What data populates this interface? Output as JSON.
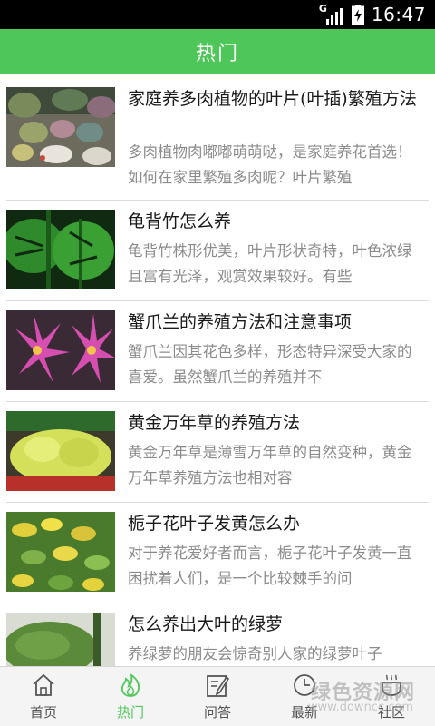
{
  "status_bar": {
    "time": "16:47",
    "network": "G"
  },
  "header": {
    "title": "热门"
  },
  "articles": [
    {
      "title": "家庭养多肉植物的叶片(叶插)繁殖方法",
      "summary": "多肉植物肉嘟嘟萌萌哒，是家庭养花首选！如何在家里繁殖多肉呢？叶片繁殖",
      "image": "succulents-photo"
    },
    {
      "title": "龟背竹怎么养",
      "summary": "龟背竹株形优美，叶片形状奇特，叶色浓绿且富有光泽，观赏效果较好。有些",
      "image": "monstera-photo"
    },
    {
      "title": "蟹爪兰的养殖方法和注意事项",
      "summary": "蟹爪兰因其花色多样，形态特异深受大家的喜爱。虽然蟹爪兰的养殖并不",
      "image": "christmas-cactus-photo"
    },
    {
      "title": "黄金万年草的养殖方法",
      "summary": "黄金万年草是薄雪万年草的自然变种，黄金万年草养殖方法也相对容",
      "image": "golden-sedum-photo"
    },
    {
      "title": "栀子花叶子发黄怎么办",
      "summary": "对于养花爱好者而言，栀子花叶子发黄一直困扰着人们，是一个比较棘手的问",
      "image": "gardenia-yellow-leaves-photo"
    },
    {
      "title": "怎么养出大叶的绿萝",
      "summary": "养绿萝的朋友会惊奇别人家的绿萝叶子",
      "image": "pothos-photo"
    }
  ],
  "tabs": [
    {
      "label": "首页",
      "icon": "home-icon"
    },
    {
      "label": "热门",
      "icon": "flame-icon"
    },
    {
      "label": "问答",
      "icon": "edit-note-icon"
    },
    {
      "label": "最新",
      "icon": "clock-icon"
    },
    {
      "label": "社区",
      "icon": "coffee-cup-icon"
    }
  ],
  "active_tab": "热门",
  "watermark": {
    "text": "绿色资源网",
    "url": "www.downcc.com"
  },
  "colors": {
    "accent": "#4fc65a",
    "status_bar": "#000000",
    "tab_bar": "#f4f4f4"
  }
}
